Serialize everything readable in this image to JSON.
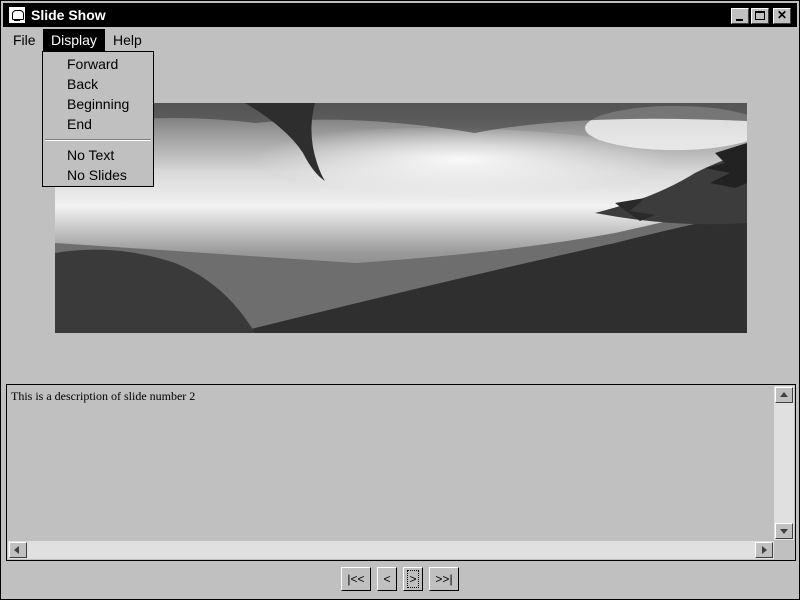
{
  "window": {
    "title": "Slide Show"
  },
  "menubar": {
    "file": "File",
    "display": "Display",
    "help": "Help"
  },
  "display_menu": {
    "items": [
      "Forward",
      "Back",
      "Beginning",
      "End"
    ],
    "options": [
      "No Text",
      "No Slides"
    ]
  },
  "slide": {
    "description": "This is a description of slide number 2"
  },
  "nav": {
    "first": "|<<",
    "prev": "<",
    "next": ">",
    "last": ">>|"
  },
  "icons": {
    "app": "app-icon",
    "minimize": "minimize-icon",
    "maximize": "maximize-icon",
    "close": "close-icon"
  }
}
